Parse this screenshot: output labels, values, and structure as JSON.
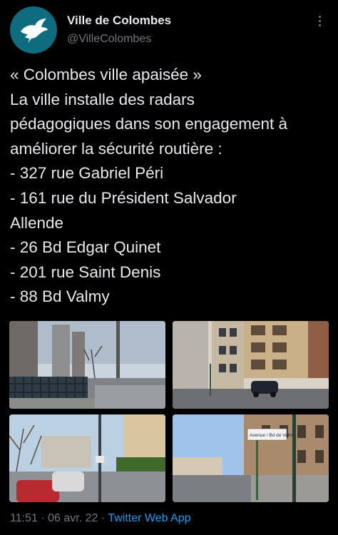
{
  "account": {
    "name": "Ville de Colombes",
    "handle": "@VilleColombes",
    "avatar_icon": "dove-logo-icon",
    "avatar_color": "#0e6c7e"
  },
  "tweet": {
    "lines": [
      "« Colombes ville apaisée »",
      "La ville installe des radars",
      "pédagogiques dans son engagement à",
      "améliorer la sécurité routière :",
      "- 327 rue Gabriel Péri",
      "- 161 rue du Président Salvador",
      "Allende",
      "- 26 Bd Edgar Quinet",
      "- 201 rue Saint Denis",
      "- 88 Bd Valmy"
    ]
  },
  "photos": {
    "count": 4,
    "sign_text": "Avenue / Bd de Valmy"
  },
  "meta": {
    "time": "11:51",
    "separator": " · ",
    "date": "06 avr. 22",
    "source": "Twitter Web App"
  },
  "colors": {
    "background": "#000000",
    "text": "#e7e9ea",
    "muted": "#71767b",
    "link": "#1d9bf0"
  }
}
